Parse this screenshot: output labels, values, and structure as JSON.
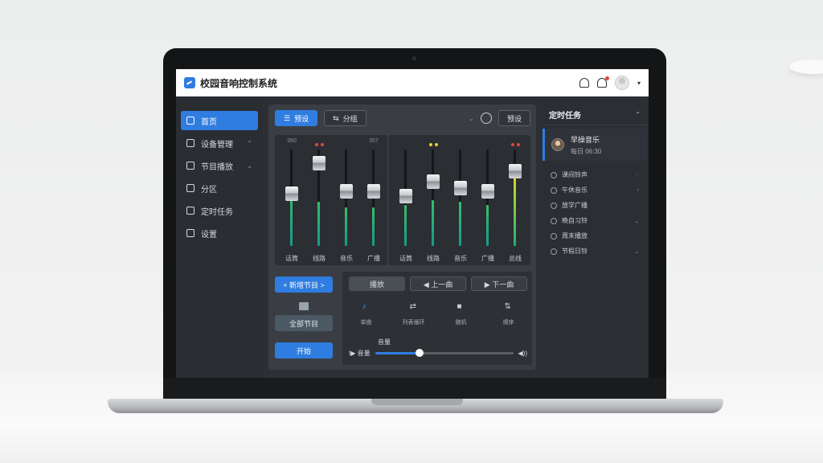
{
  "header": {
    "title": "校园音响控制系统"
  },
  "sidebar": {
    "items": [
      {
        "label": "首页",
        "arrow": ""
      },
      {
        "label": "设备管理",
        "arrow": "⌃"
      },
      {
        "label": "节目播放",
        "arrow": "⌄"
      },
      {
        "label": "分区",
        "arrow": ""
      },
      {
        "label": "定时任务",
        "arrow": ""
      },
      {
        "label": "设置",
        "arrow": ""
      }
    ]
  },
  "toolbar": {
    "primary": "预设",
    "secondary": "分组"
  },
  "bank_left": {
    "channels": [
      {
        "top": "350",
        "level": 0.62,
        "fader": 0.55,
        "leds": [],
        "label": "话筒"
      },
      {
        "top": "",
        "level": 0.5,
        "fader": 0.92,
        "leds": [
          "#e4473a",
          "#e4473a"
        ],
        "label": "线路"
      },
      {
        "top": "",
        "level": 0.44,
        "fader": 0.58,
        "leds": [],
        "label": "音乐"
      },
      {
        "top": "357",
        "level": 0.44,
        "fader": 0.58,
        "leds": [],
        "label": "广播"
      }
    ]
  },
  "bank_right": {
    "channels": [
      {
        "top": "",
        "level": 0.46,
        "fader": 0.52,
        "leds": [],
        "label": "话筒"
      },
      {
        "top": "",
        "level": 0.52,
        "fader": 0.7,
        "leds": [
          "#e6d32c",
          "#e6d32c"
        ],
        "label": "线路"
      },
      {
        "top": "",
        "level": 0.5,
        "fader": 0.62,
        "leds": [],
        "label": "音乐"
      },
      {
        "top": "",
        "level": 0.46,
        "fader": 0.58,
        "leds": [],
        "label": "广播"
      },
      {
        "top": "",
        "level": 0.82,
        "fader": 0.82,
        "leds": [
          "#e4473a",
          "#e4473a"
        ],
        "label": "总线"
      }
    ]
  },
  "lower_left": {
    "add": "+ 新增节目 >",
    "middle": "全部节目",
    "start": "开始"
  },
  "transport": {
    "buttons": [
      "播放",
      "◀ 上一曲",
      "▶ 下一曲"
    ],
    "modes": [
      "单曲",
      "列表循环",
      "随机",
      "顺序"
    ],
    "volume_label": "音量",
    "vol_prefix": "I▶ 音量",
    "vol_suffix": "◀))",
    "volume": 0.32
  },
  "tasks": {
    "title": "定时任务",
    "active": {
      "title": "早操音乐",
      "sub": "每日 06:30"
    },
    "rows": [
      {
        "label": "课间铃声",
        "arrow": "··"
      },
      {
        "label": "午休音乐",
        "arrow": "›"
      },
      {
        "label": "放学广播",
        "arrow": ""
      },
      {
        "label": "晚自习铃",
        "arrow": "⌄"
      },
      {
        "label": "周末播放",
        "arrow": ""
      },
      {
        "label": "节假日铃",
        "arrow": "⌄"
      }
    ]
  }
}
